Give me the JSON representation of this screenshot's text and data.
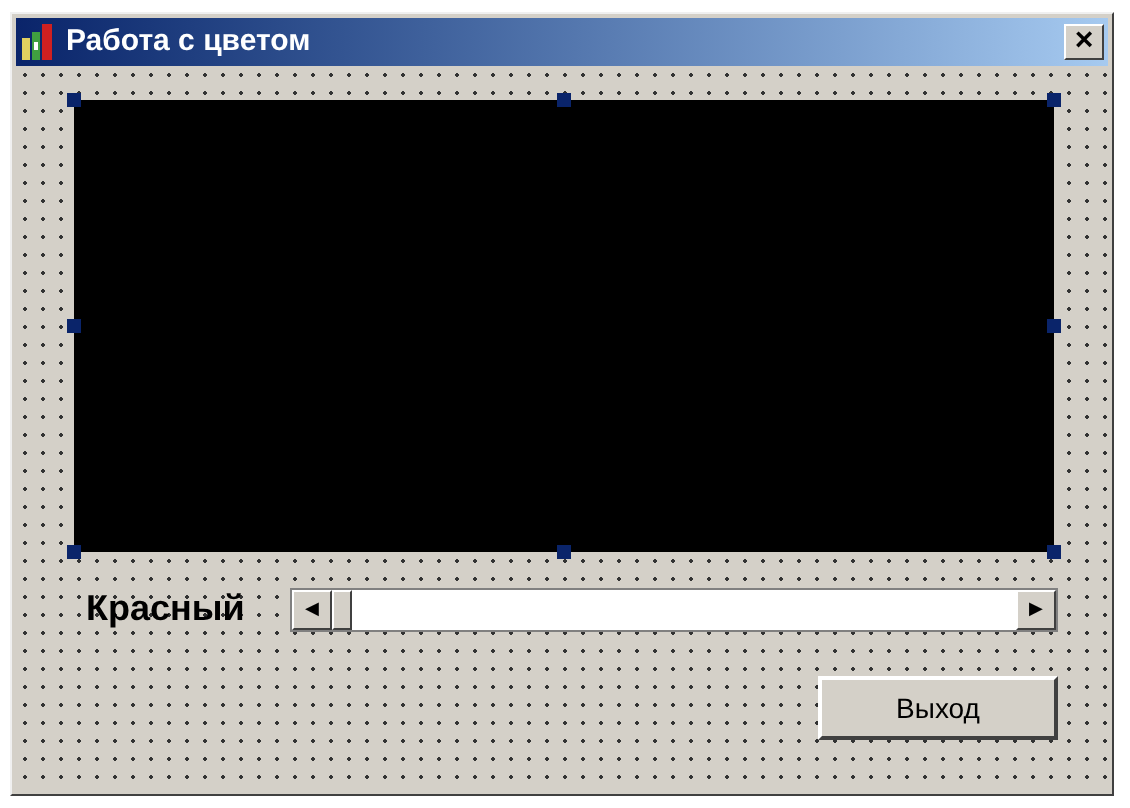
{
  "window": {
    "title": "Работа с цветом",
    "close": "×"
  },
  "color_panel": {
    "selected": true
  },
  "scrollbar": {
    "label": "Красный",
    "left": "◀",
    "right": "▶"
  },
  "buttons": [
    {
      "label": "Выход"
    }
  ]
}
